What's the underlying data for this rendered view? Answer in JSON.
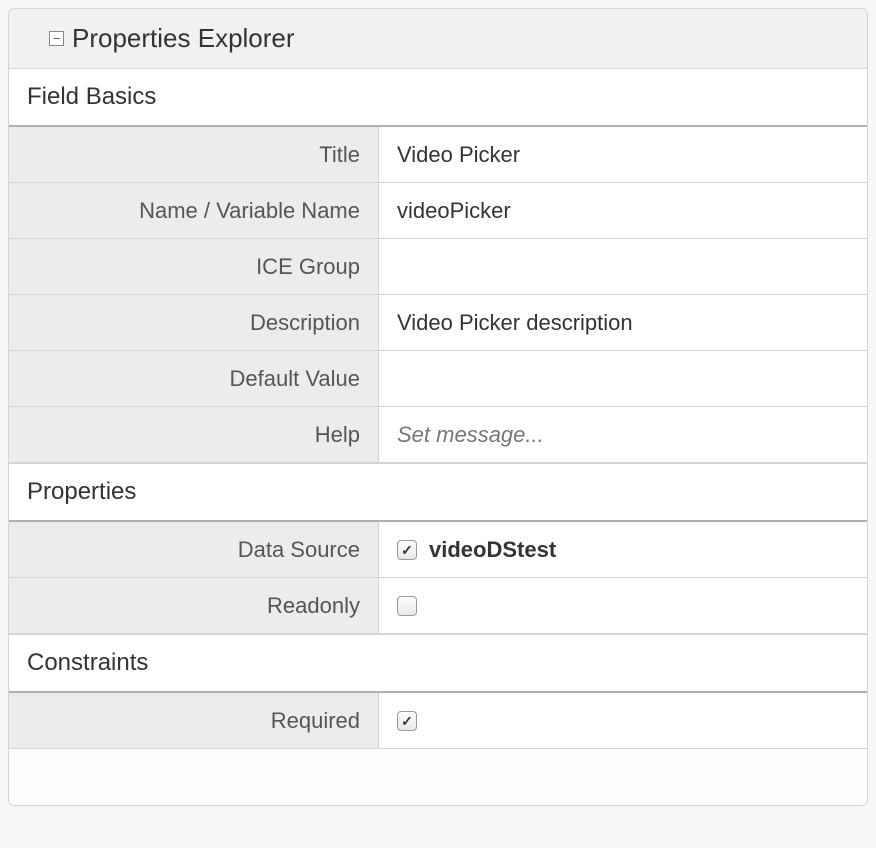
{
  "panel": {
    "title": "Properties Explorer"
  },
  "sections": {
    "fieldBasics": {
      "header": "Field Basics",
      "rows": {
        "title": {
          "label": "Title",
          "value": "Video Picker"
        },
        "name": {
          "label": "Name / Variable Name",
          "value": "videoPicker"
        },
        "iceGroup": {
          "label": "ICE Group",
          "value": ""
        },
        "description": {
          "label": "Description",
          "value": "Video Picker description"
        },
        "defaultValue": {
          "label": "Default Value",
          "value": ""
        },
        "help": {
          "label": "Help",
          "placeholder": "Set message..."
        }
      }
    },
    "properties": {
      "header": "Properties",
      "rows": {
        "dataSource": {
          "label": "Data Source",
          "checked": true,
          "dsName": "videoDStest"
        },
        "readonly": {
          "label": "Readonly",
          "checked": false
        }
      }
    },
    "constraints": {
      "header": "Constraints",
      "rows": {
        "required": {
          "label": "Required",
          "checked": true
        }
      }
    }
  }
}
